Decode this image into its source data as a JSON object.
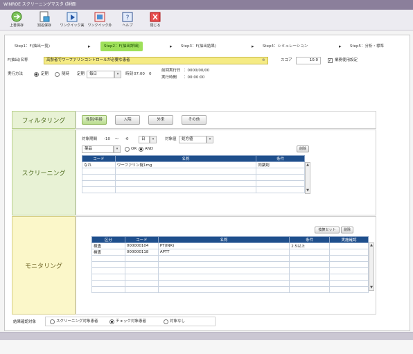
{
  "window": {
    "title": "WINROE スクリーニングマスタ (詳細)"
  },
  "toolbar": {
    "buttons": [
      {
        "label": "上書保存",
        "icon": "save-icon"
      },
      {
        "label": "別名保存",
        "icon": "save-as-icon"
      },
      {
        "label": "ワンクイック実",
        "icon": "run-icon"
      },
      {
        "label": "ワンクイック外",
        "icon": "export-icon"
      },
      {
        "label": "ヘルプ",
        "icon": "help-icon"
      },
      {
        "label": "閉じる",
        "icon": "close-icon"
      }
    ]
  },
  "steps": [
    {
      "label": "Step1：F(抽出一覧)",
      "active": false
    },
    {
      "label": "Step2：F(抽出詳細)",
      "active": true
    },
    {
      "label": "Step3：F(抽出結果)",
      "active": false
    },
    {
      "label": "Step4：シミュレーション",
      "active": false
    },
    {
      "label": "Step5：分析・標準",
      "active": false
    }
  ],
  "form": {
    "name_label": "F(抽出)名称",
    "name_value": "高齢者でワーファリンコントロールが必要な患者",
    "score_label": "スコア",
    "score_value": "10.0",
    "enabled_label": "業務使用設定",
    "schedule_label": "実行方法",
    "radio_fixed": "定期",
    "radio_manual": "随時",
    "period_label": "定期",
    "period_value": "毎日",
    "time_label": "時刻",
    "time_value": "07:00",
    "time_suffix": "0",
    "last_run_label": "前回実行日",
    "last_run_value": "：0000/00/00",
    "run_time_label": "実行時間",
    "run_time_value": "：00:00:00"
  },
  "filtering": {
    "label": "フィルタリング",
    "buttons": [
      "性別/年齢",
      "入院",
      "外来",
      "その他"
    ]
  },
  "screening": {
    "label": "スクリーニング",
    "range_label": "対象期間",
    "range_from": "-10",
    "range_sep": "〜",
    "range_to": "-0",
    "range_unit": "日",
    "target_label": "対象値",
    "target_value": "処方値",
    "type_value": "薬品",
    "or_label": "OR",
    "and_label": "AND",
    "delete_button": "削除",
    "columns": [
      "コード",
      "名称",
      "条件"
    ],
    "rows": [
      {
        "code": "なれ",
        "name": "ワーファリン錠1mg",
        "cond": "同薬剤"
      },
      {
        "code": "",
        "name": "",
        "cond": ""
      },
      {
        "code": "",
        "name": "",
        "cond": ""
      },
      {
        "code": "",
        "name": "",
        "cond": ""
      },
      {
        "code": "",
        "name": "",
        "cond": ""
      }
    ]
  },
  "monitoring": {
    "label": "モニタリング",
    "preset_button": "換算セット",
    "delete_button": "削除",
    "columns": [
      "区分",
      "コード",
      "名称",
      "条件",
      "実施確認"
    ],
    "rows": [
      {
        "kind": "検査",
        "code": "000000104",
        "name": "PT(INR)",
        "cond": "2.5以上",
        "check": ""
      },
      {
        "kind": "検査",
        "code": "000000118",
        "name": "APTT",
        "cond": "",
        "check": ""
      },
      {
        "kind": "",
        "code": "",
        "name": "",
        "cond": "",
        "check": ""
      },
      {
        "kind": "",
        "code": "",
        "name": "",
        "cond": "",
        "check": ""
      },
      {
        "kind": "",
        "code": "",
        "name": "",
        "cond": "",
        "check": ""
      },
      {
        "kind": "",
        "code": "",
        "name": "",
        "cond": "",
        "check": ""
      },
      {
        "kind": "",
        "code": "",
        "name": "",
        "cond": "",
        "check": ""
      },
      {
        "kind": "",
        "code": "",
        "name": "",
        "cond": "",
        "check": ""
      }
    ]
  },
  "target": {
    "label": "結果確認対象",
    "options": [
      "スクリーニング対象患者",
      "チェック対象患者",
      "対象なし"
    ],
    "selected": 1
  }
}
